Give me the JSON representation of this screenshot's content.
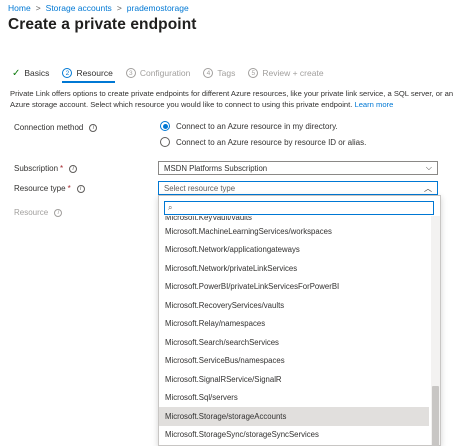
{
  "breadcrumb": {
    "items": [
      "Home",
      "Storage accounts",
      "prademostorage"
    ],
    "separator": ">"
  },
  "title": "Create a private endpoint",
  "steps": [
    {
      "num": "",
      "label": "Basics",
      "state": "done"
    },
    {
      "num": "2",
      "label": "Resource",
      "state": "active"
    },
    {
      "num": "3",
      "label": "Configuration",
      "state": "disabled"
    },
    {
      "num": "4",
      "label": "Tags",
      "state": "disabled"
    },
    {
      "num": "5",
      "label": "Review + create",
      "state": "disabled"
    }
  ],
  "intro": {
    "text": "Private Link offers options to create private endpoints for different Azure resources, like your private link service, a SQL server, or an Azure storage account. Select which resource you would like to connect to using this private endpoint.",
    "link": "Learn more"
  },
  "form": {
    "connection_method": {
      "label": "Connection method",
      "options": [
        {
          "label": "Connect to an Azure resource in my directory.",
          "checked": true
        },
        {
          "label": "Connect to an Azure resource by resource ID or alias.",
          "checked": false
        }
      ]
    },
    "subscription": {
      "label": "Subscription",
      "required": "*",
      "value": "MSDN Platforms Subscription"
    },
    "resource_type": {
      "label": "Resource type",
      "required": "*",
      "placeholder": "Select resource type"
    },
    "resource": {
      "label": "Resource"
    }
  },
  "dropdown": {
    "search_value": "",
    "clipped_item": "Microsoft.KeyVault/vaults",
    "items": [
      "Microsoft.MachineLearningServices/workspaces",
      "Microsoft.Network/applicationgateways",
      "Microsoft.Network/privateLinkServices",
      "Microsoft.PowerBI/privateLinkServicesForPowerBI",
      "Microsoft.RecoveryServices/vaults",
      "Microsoft.Relay/namespaces",
      "Microsoft.Search/searchServices",
      "Microsoft.ServiceBus/namespaces",
      "Microsoft.SignalRService/SignalR",
      "Microsoft.Sql/servers",
      "Microsoft.Storage/storageAccounts",
      "Microsoft.StorageSync/storageSyncServices"
    ],
    "selected": "Microsoft.Storage/storageAccounts"
  },
  "colors": {
    "accent": "#0078d4",
    "success": "#107c10",
    "required": "#a4262c",
    "selected_bg": "#e1dfdd"
  },
  "icons": {
    "check": "checkmark-icon",
    "info": "info-icon",
    "chevron": "chevron-down-icon",
    "search": "search-icon"
  }
}
